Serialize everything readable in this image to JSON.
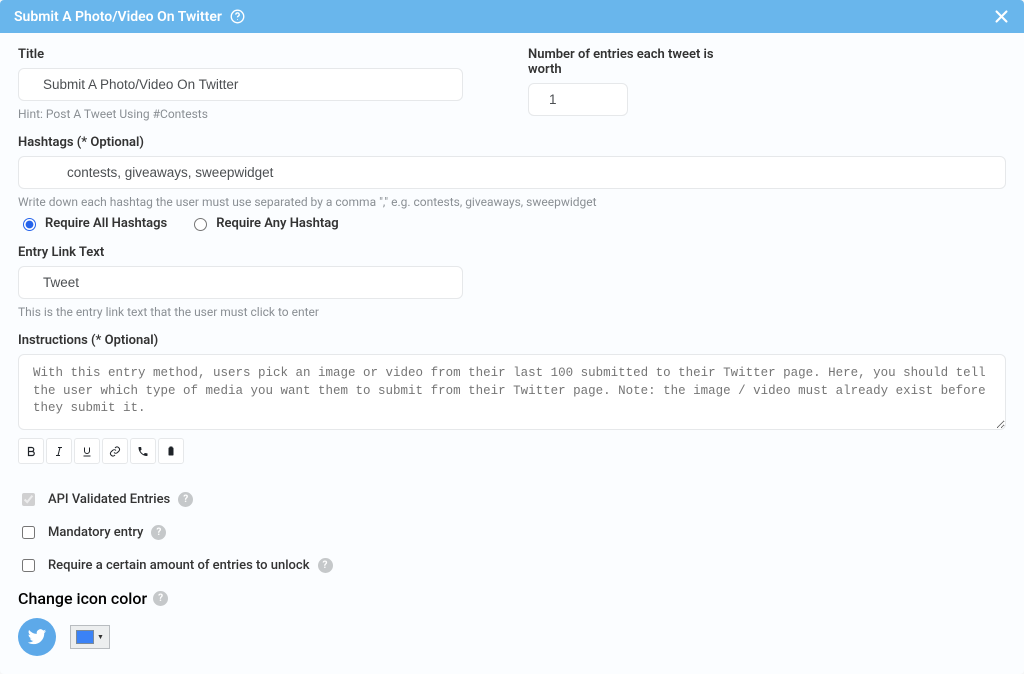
{
  "header": {
    "title": "Submit A Photo/Video On Twitter"
  },
  "title": {
    "label": "Title",
    "value": "Submit A Photo/Video On Twitter",
    "hint": "Hint: Post A Tweet Using #Contests"
  },
  "entries": {
    "label": "Number of entries each tweet is worth",
    "value": "1"
  },
  "hashtags": {
    "label": "Hashtags (* Optional)",
    "value": "contests, giveaways, sweepwidget",
    "hint": "Write down each hashtag the user must use separated by a comma \",\" e.g. contests, giveaways, sweepwidget"
  },
  "hashtagMode": {
    "all": "Require All Hashtags",
    "any": "Require Any Hashtag"
  },
  "entryLink": {
    "label": "Entry Link Text",
    "value": "Tweet",
    "hint": "This is the entry link text that the user must click to enter"
  },
  "instructions": {
    "label": "Instructions (* Optional)",
    "placeholder": "With this entry method, users pick an image or video from their last 100 submitted to their Twitter page. Here, you should tell the user which type of media you want them to submit from their Twitter page. Note: the image / video must already exist before they submit it."
  },
  "options": {
    "apiValidated": "API Validated Entries",
    "mandatory": "Mandatory entry",
    "unlock": "Require a certain amount of entries to unlock"
  },
  "iconColor": {
    "label": "Change icon color",
    "value": "#3b82f6"
  }
}
